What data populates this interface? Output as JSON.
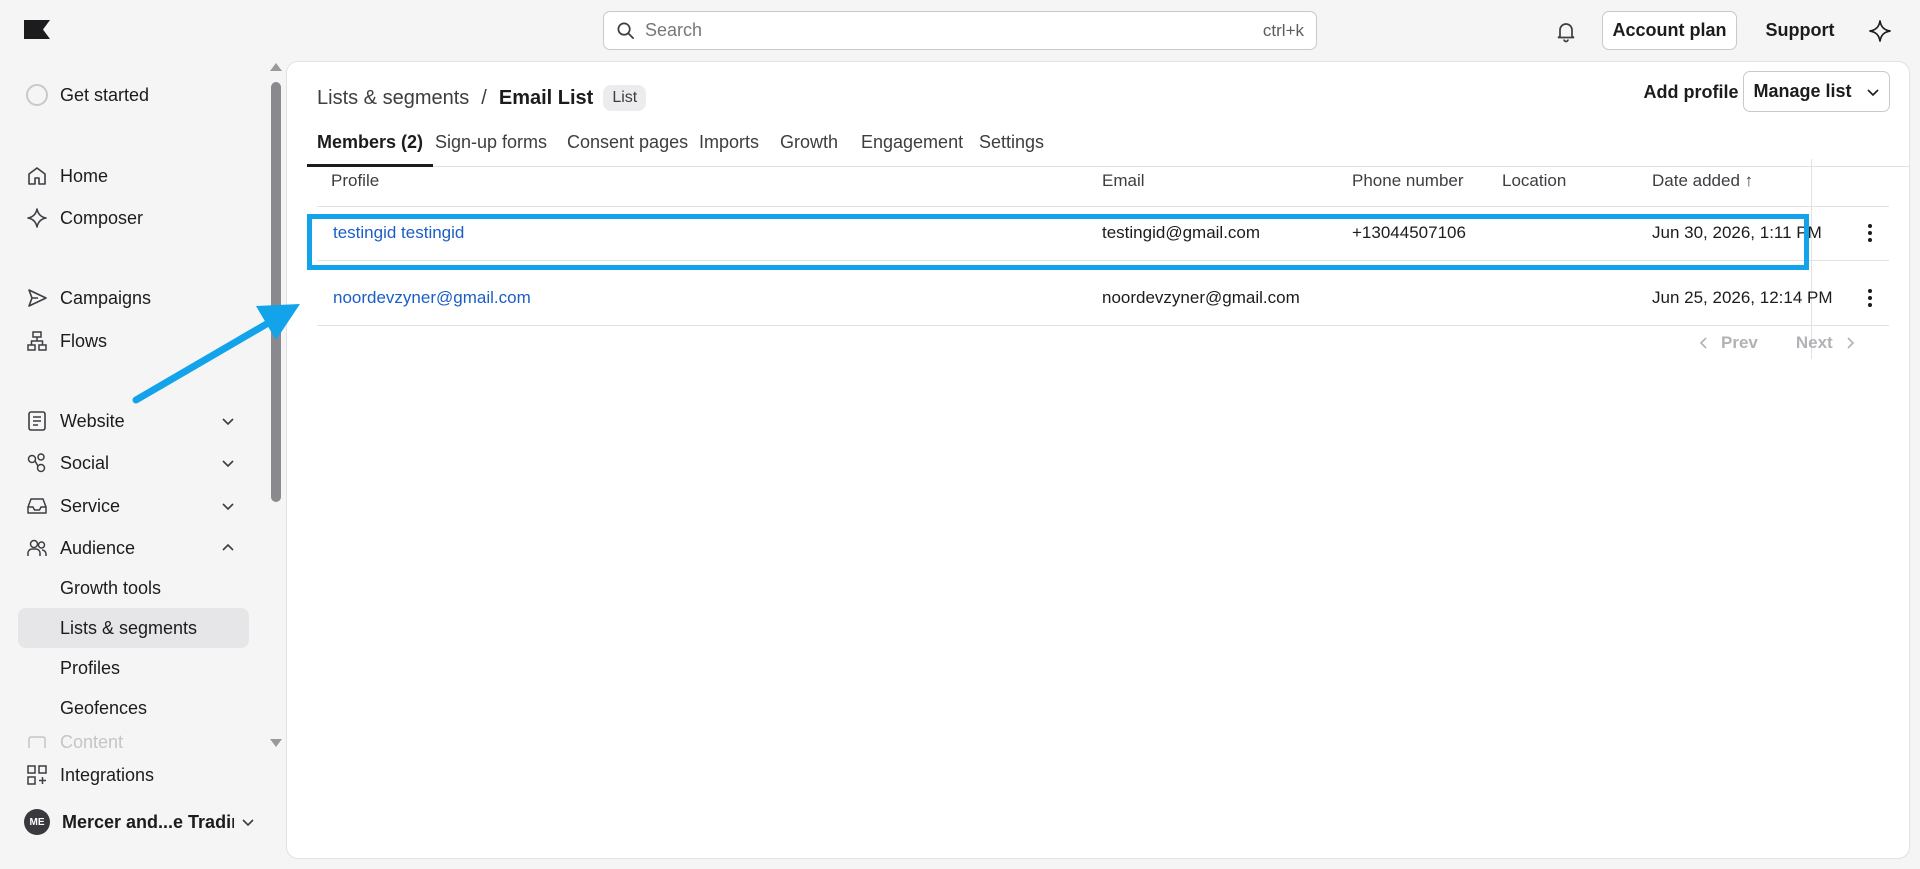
{
  "colors": {
    "accent_link": "#1a5fc7",
    "highlight": "#12a3ea",
    "active_nav_bg": "#e6e6e8"
  },
  "topbar": {
    "logo_icon": "flag-icon",
    "search_placeholder": "Search",
    "search_shortcut": "ctrl+k",
    "account_plan": "Account plan",
    "support": "Support"
  },
  "sidebar": {
    "get_started": "Get started",
    "items": [
      {
        "label": "Home",
        "icon": "home-icon"
      },
      {
        "label": "Composer",
        "icon": "sparkle-icon"
      },
      {
        "label": "Campaigns",
        "icon": "send-icon"
      },
      {
        "label": "Flows",
        "icon": "flow-icon"
      },
      {
        "label": "Website",
        "icon": "document-icon"
      },
      {
        "label": "Social",
        "icon": "share-icon"
      },
      {
        "label": "Service",
        "icon": "inbox-icon"
      },
      {
        "label": "Audience",
        "icon": "users-icon"
      }
    ],
    "audience_sub": [
      "Growth tools",
      "Lists & segments",
      "Profiles",
      "Geofences"
    ],
    "content_faded": "Content",
    "integrations": "Integrations",
    "org_initials": "ME",
    "org_name": "Mercer and...e Trading"
  },
  "main": {
    "breadcrumb_parent": "Lists & segments",
    "breadcrumb_sep": "/",
    "breadcrumb_current": "Email List",
    "breadcrumb_badge": "List",
    "add_profile": "Add profile",
    "manage_list": "Manage list",
    "tabs": [
      "Members (2)",
      "Sign-up forms",
      "Consent pages",
      "Imports",
      "Growth",
      "Engagement",
      "Settings"
    ],
    "table": {
      "headers": {
        "profile": "Profile",
        "email": "Email",
        "phone": "Phone number",
        "location": "Location",
        "date_added": "Date added ↑"
      },
      "rows": [
        {
          "profile": "testingid testingid",
          "email": "testingid@gmail.com",
          "phone": "+13044507106",
          "location": "",
          "date_added": "Jun 30, 2026, 1:11 PM"
        },
        {
          "profile": "noordevzyner@gmail.com",
          "email": "noordevzyner@gmail.com",
          "phone": "",
          "location": "",
          "date_added": "Jun 25, 2026, 12:14 PM"
        }
      ]
    },
    "pager": {
      "prev": "Prev",
      "next": "Next"
    }
  }
}
